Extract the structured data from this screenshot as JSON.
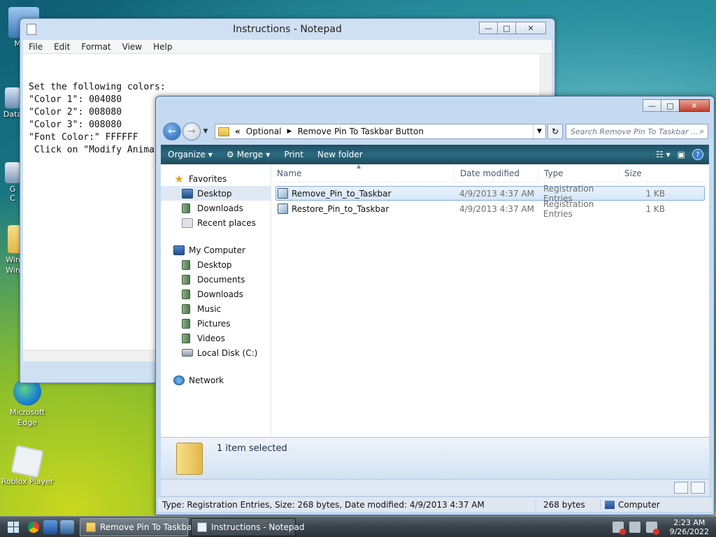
{
  "desktop": {
    "icons": [
      {
        "label": "My C"
      },
      {
        "label": "Data"
      },
      {
        "label": "G\nC"
      },
      {
        "label": "Wind\nWind"
      },
      {
        "label": "Microsoft\nEdge"
      },
      {
        "label": "Roblox Player"
      }
    ]
  },
  "notepad": {
    "title": "Instructions - Notepad",
    "menu": [
      "File",
      "Edit",
      "Format",
      "View",
      "Help"
    ],
    "content": "Set the following colors:\n\"Color 1\": 004080\n\"Color 2\": 008080\n\"Color 3\": 008080\n\"Font Color:\" FFFFFF\n Click on \"Modify Anima"
  },
  "explorer": {
    "address": {
      "sep": "«",
      "crumbs": [
        "Optional",
        "Remove Pin To Taskbar Button"
      ]
    },
    "search_placeholder": "Search Remove Pin To Taskbar ...",
    "toolbar": {
      "organize": "Organize",
      "merge": "Merge",
      "print": "Print",
      "new_folder": "New folder"
    },
    "nav": {
      "favorites_head": "Favorites",
      "favorites": [
        "Desktop",
        "Downloads",
        "Recent places"
      ],
      "computer_head": "My Computer",
      "computer": [
        "Desktop",
        "Documents",
        "Downloads",
        "Music",
        "Pictures",
        "Videos",
        "Local Disk (C:)"
      ],
      "network": "Network"
    },
    "columns": {
      "name": "Name",
      "date": "Date modified",
      "type": "Type",
      "size": "Size"
    },
    "files": [
      {
        "name": "Remove_Pin_to_Taskbar",
        "date": "4/9/2013 4:37 AM",
        "type": "Registration Entries",
        "size": "1 KB",
        "selected": true
      },
      {
        "name": "Restore_Pin_to_Taskbar",
        "date": "4/9/2013 4:37 AM",
        "type": "Registration Entries",
        "size": "1 KB",
        "selected": false
      }
    ],
    "details_text": "1 item selected",
    "status": {
      "main": "Type: Registration Entries, Size: 268 bytes, Date modified: 4/9/2013 4:37 AM",
      "size": "268 bytes",
      "location": "Computer"
    }
  },
  "taskbar": {
    "tasks": [
      {
        "label": "Remove Pin To Taskbar ...",
        "active": true
      },
      {
        "label": "Instructions - Notepad",
        "active": false
      }
    ],
    "clock": {
      "time": "2:23 AM",
      "date": "9/26/2022"
    }
  }
}
